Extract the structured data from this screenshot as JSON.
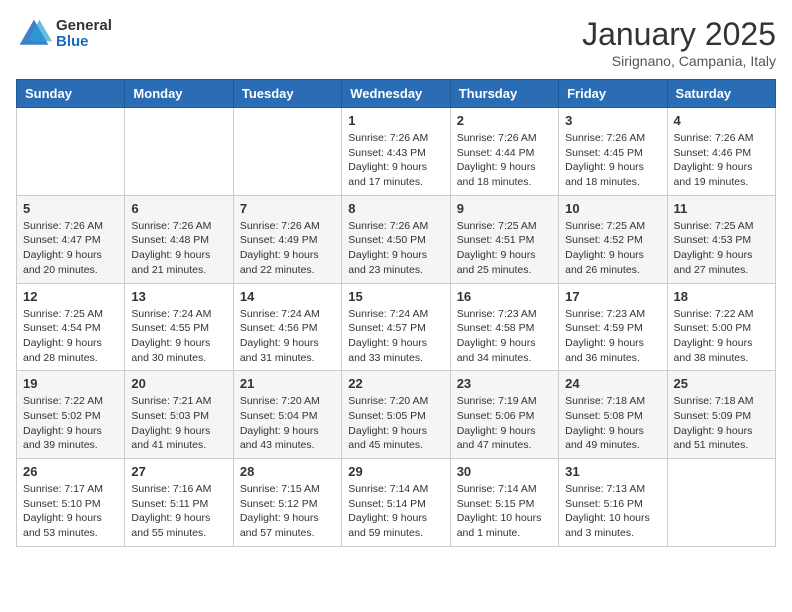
{
  "header": {
    "logo_general": "General",
    "logo_blue": "Blue",
    "title": "January 2025",
    "location": "Sirignano, Campania, Italy"
  },
  "weekdays": [
    "Sunday",
    "Monday",
    "Tuesday",
    "Wednesday",
    "Thursday",
    "Friday",
    "Saturday"
  ],
  "weeks": [
    [
      {
        "day": "",
        "info": ""
      },
      {
        "day": "",
        "info": ""
      },
      {
        "day": "",
        "info": ""
      },
      {
        "day": "1",
        "info": "Sunrise: 7:26 AM\nSunset: 4:43 PM\nDaylight: 9 hours\nand 17 minutes."
      },
      {
        "day": "2",
        "info": "Sunrise: 7:26 AM\nSunset: 4:44 PM\nDaylight: 9 hours\nand 18 minutes."
      },
      {
        "day": "3",
        "info": "Sunrise: 7:26 AM\nSunset: 4:45 PM\nDaylight: 9 hours\nand 18 minutes."
      },
      {
        "day": "4",
        "info": "Sunrise: 7:26 AM\nSunset: 4:46 PM\nDaylight: 9 hours\nand 19 minutes."
      }
    ],
    [
      {
        "day": "5",
        "info": "Sunrise: 7:26 AM\nSunset: 4:47 PM\nDaylight: 9 hours\nand 20 minutes."
      },
      {
        "day": "6",
        "info": "Sunrise: 7:26 AM\nSunset: 4:48 PM\nDaylight: 9 hours\nand 21 minutes."
      },
      {
        "day": "7",
        "info": "Sunrise: 7:26 AM\nSunset: 4:49 PM\nDaylight: 9 hours\nand 22 minutes."
      },
      {
        "day": "8",
        "info": "Sunrise: 7:26 AM\nSunset: 4:50 PM\nDaylight: 9 hours\nand 23 minutes."
      },
      {
        "day": "9",
        "info": "Sunrise: 7:25 AM\nSunset: 4:51 PM\nDaylight: 9 hours\nand 25 minutes."
      },
      {
        "day": "10",
        "info": "Sunrise: 7:25 AM\nSunset: 4:52 PM\nDaylight: 9 hours\nand 26 minutes."
      },
      {
        "day": "11",
        "info": "Sunrise: 7:25 AM\nSunset: 4:53 PM\nDaylight: 9 hours\nand 27 minutes."
      }
    ],
    [
      {
        "day": "12",
        "info": "Sunrise: 7:25 AM\nSunset: 4:54 PM\nDaylight: 9 hours\nand 28 minutes."
      },
      {
        "day": "13",
        "info": "Sunrise: 7:24 AM\nSunset: 4:55 PM\nDaylight: 9 hours\nand 30 minutes."
      },
      {
        "day": "14",
        "info": "Sunrise: 7:24 AM\nSunset: 4:56 PM\nDaylight: 9 hours\nand 31 minutes."
      },
      {
        "day": "15",
        "info": "Sunrise: 7:24 AM\nSunset: 4:57 PM\nDaylight: 9 hours\nand 33 minutes."
      },
      {
        "day": "16",
        "info": "Sunrise: 7:23 AM\nSunset: 4:58 PM\nDaylight: 9 hours\nand 34 minutes."
      },
      {
        "day": "17",
        "info": "Sunrise: 7:23 AM\nSunset: 4:59 PM\nDaylight: 9 hours\nand 36 minutes."
      },
      {
        "day": "18",
        "info": "Sunrise: 7:22 AM\nSunset: 5:00 PM\nDaylight: 9 hours\nand 38 minutes."
      }
    ],
    [
      {
        "day": "19",
        "info": "Sunrise: 7:22 AM\nSunset: 5:02 PM\nDaylight: 9 hours\nand 39 minutes."
      },
      {
        "day": "20",
        "info": "Sunrise: 7:21 AM\nSunset: 5:03 PM\nDaylight: 9 hours\nand 41 minutes."
      },
      {
        "day": "21",
        "info": "Sunrise: 7:20 AM\nSunset: 5:04 PM\nDaylight: 9 hours\nand 43 minutes."
      },
      {
        "day": "22",
        "info": "Sunrise: 7:20 AM\nSunset: 5:05 PM\nDaylight: 9 hours\nand 45 minutes."
      },
      {
        "day": "23",
        "info": "Sunrise: 7:19 AM\nSunset: 5:06 PM\nDaylight: 9 hours\nand 47 minutes."
      },
      {
        "day": "24",
        "info": "Sunrise: 7:18 AM\nSunset: 5:08 PM\nDaylight: 9 hours\nand 49 minutes."
      },
      {
        "day": "25",
        "info": "Sunrise: 7:18 AM\nSunset: 5:09 PM\nDaylight: 9 hours\nand 51 minutes."
      }
    ],
    [
      {
        "day": "26",
        "info": "Sunrise: 7:17 AM\nSunset: 5:10 PM\nDaylight: 9 hours\nand 53 minutes."
      },
      {
        "day": "27",
        "info": "Sunrise: 7:16 AM\nSunset: 5:11 PM\nDaylight: 9 hours\nand 55 minutes."
      },
      {
        "day": "28",
        "info": "Sunrise: 7:15 AM\nSunset: 5:12 PM\nDaylight: 9 hours\nand 57 minutes."
      },
      {
        "day": "29",
        "info": "Sunrise: 7:14 AM\nSunset: 5:14 PM\nDaylight: 9 hours\nand 59 minutes."
      },
      {
        "day": "30",
        "info": "Sunrise: 7:14 AM\nSunset: 5:15 PM\nDaylight: 10 hours\nand 1 minute."
      },
      {
        "day": "31",
        "info": "Sunrise: 7:13 AM\nSunset: 5:16 PM\nDaylight: 10 hours\nand 3 minutes."
      },
      {
        "day": "",
        "info": ""
      }
    ]
  ]
}
